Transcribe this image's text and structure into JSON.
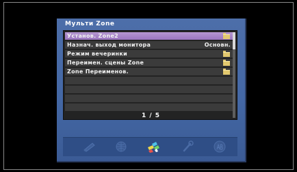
{
  "menu": {
    "title": "Мульти Zone",
    "items": [
      {
        "label": "Установ. Zone2",
        "value": "",
        "icon": "folder-icon",
        "selected": true
      },
      {
        "label": "Назнач. выход монитора",
        "value": "Основн.",
        "icon": "",
        "selected": false
      },
      {
        "label": "Режим вечеринки",
        "value": "",
        "icon": "folder-icon",
        "selected": false
      },
      {
        "label": "Переимен. сцены Zone",
        "value": "",
        "icon": "folder-icon",
        "selected": false
      },
      {
        "label": "Zone Переименов.",
        "value": "",
        "icon": "folder-icon",
        "selected": false
      }
    ],
    "empty_rows": 4,
    "page": "1 / 5"
  },
  "toolbar": {
    "icons": [
      {
        "name": "speaker-setup-icon",
        "active": false
      },
      {
        "name": "globe-network-icon",
        "active": false
      },
      {
        "name": "multi-zone-icon",
        "active": true
      },
      {
        "name": "wrench-icon",
        "active": false
      },
      {
        "name": "abc-language-icon",
        "active": false
      }
    ]
  },
  "colors": {
    "panel": "#4468a5",
    "selected_row": "#a783c8",
    "row": "#3b3b3b",
    "text": "#ffffff"
  }
}
